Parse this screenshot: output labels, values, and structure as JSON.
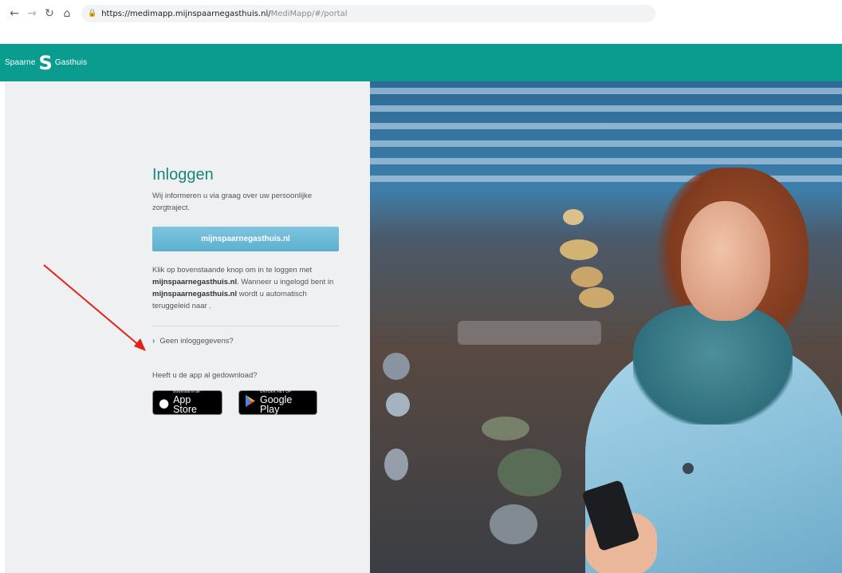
{
  "browser": {
    "back_icon": "arrow-left-icon",
    "forward_icon": "arrow-right-icon",
    "reload_icon": "reload-icon",
    "home_icon": "home-icon",
    "lock_icon": "lock-icon",
    "url_host": "https://medimapp.mijnspaarnegasthuis.nl/",
    "url_path": "MediMapp/#/portal"
  },
  "header": {
    "logo_left": "Spaarne",
    "logo_mark": "S",
    "logo_right": "Gasthuis",
    "color": "#0a9c8e"
  },
  "login": {
    "title": "Inloggen",
    "intro": "Wij informeren u via graag over uw persoonlijke zorgtraject.",
    "button_label": "mijnspaarnegasthuis.nl",
    "description_part1": "Klik op bovenstaande knop om in te loggen met ",
    "description_bold1": "mijnspaarnegasthuis.nl",
    "description_part2": ". Wanneer u ingelogd bent in ",
    "description_bold2": "mijnspaarnegasthuis.nl",
    "description_part3": " wordt u automatisch teruggeleid naar .",
    "no_login_link": "Geen inloggegevens?",
    "app_question": "Heeft u de app al gedownload?"
  },
  "stores": {
    "apple_small": "Download in de",
    "apple_big": "App Store",
    "google_small": "ONTDEK HET OP",
    "google_big": "Google Play"
  },
  "annotation": {
    "arrow_color": "#e2231a"
  }
}
